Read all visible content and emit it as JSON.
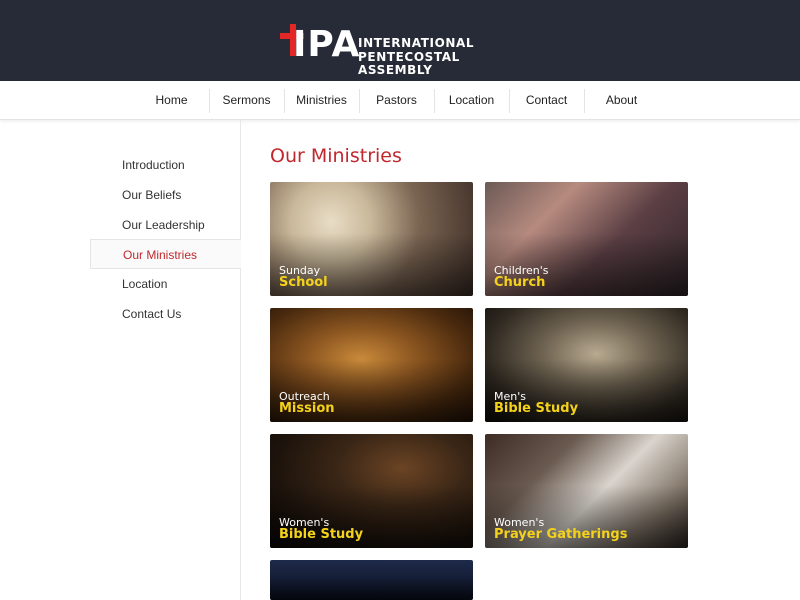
{
  "header": {
    "logo_mark": "IPA",
    "org_name_line1": "INTERNATIONAL",
    "org_name_line2": "PENTECOSTAL ASSEMBLY",
    "brand_color": "#e32626",
    "bar_color": "#262b37"
  },
  "nav": {
    "items": [
      "Home",
      "Sermons",
      "Ministries",
      "Pastors",
      "Location",
      "Contact",
      "About"
    ]
  },
  "sidebar": {
    "items": [
      "Introduction",
      "Our Beliefs",
      "Our Leadership",
      "Our Ministries",
      "Location",
      "Contact Us"
    ],
    "active": "Our Ministries",
    "active_color": "#c0282d"
  },
  "main": {
    "title": "Our Ministries",
    "tiles": [
      {
        "line1": "Sunday",
        "line2": "School"
      },
      {
        "line1": "Children's",
        "line2": "Church"
      },
      {
        "line1": "Outreach",
        "line2": "Mission"
      },
      {
        "line1": "Men's",
        "line2": "Bible Study"
      },
      {
        "line1": "Women's",
        "line2": "Bible Study"
      },
      {
        "line1": "Women's",
        "line2": "Prayer Gatherings"
      }
    ],
    "accent_color": "#f4d21b"
  }
}
